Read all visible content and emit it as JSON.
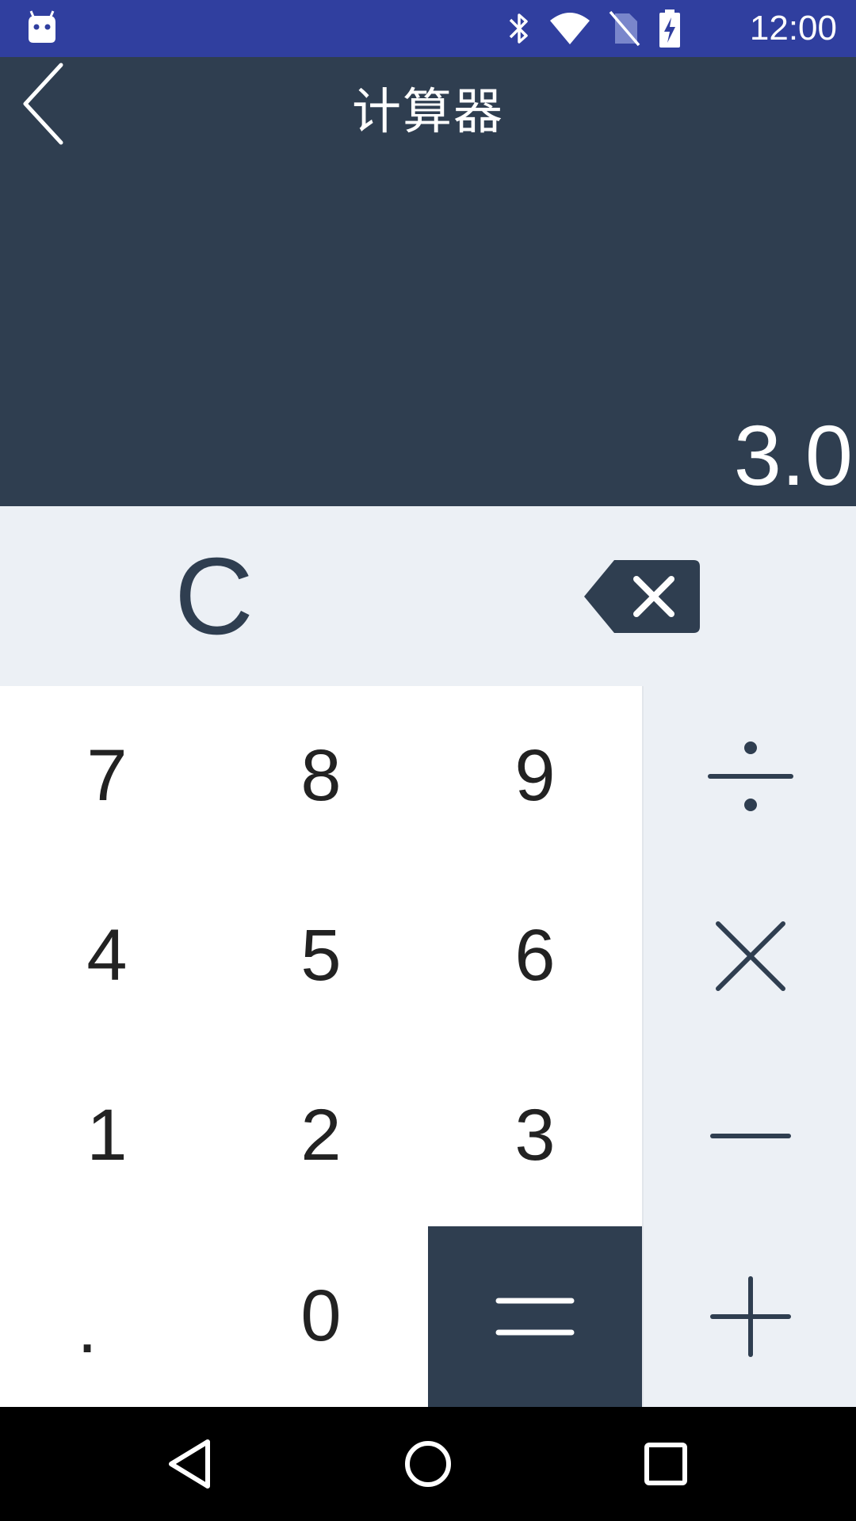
{
  "status_bar": {
    "time": "12:00",
    "icons": [
      "android-icon",
      "bluetooth-icon",
      "wifi-icon",
      "no-sim-icon",
      "battery-charging-icon"
    ],
    "background": "#303f9f"
  },
  "header": {
    "title": "计算器",
    "display_value": "3.0",
    "background": "#2f3e50"
  },
  "controls": {
    "clear_label": "C",
    "backspace_icon": "backspace-icon"
  },
  "keypad": {
    "rows": [
      [
        "7",
        "8",
        "9"
      ],
      [
        "4",
        "5",
        "6"
      ],
      [
        "1",
        "2",
        "3"
      ],
      [
        ".",
        "0"
      ]
    ]
  },
  "operators": [
    "divide-icon",
    "multiply-icon",
    "minus-icon",
    "plus-icon"
  ],
  "equals_icon": "equals-icon",
  "nav_bar": {
    "icons": [
      "back-icon",
      "home-icon",
      "recents-icon"
    ]
  },
  "colors": {
    "primary_dark": "#2f3e50",
    "light_panel": "#ecf0f5",
    "status": "#303f9f"
  }
}
